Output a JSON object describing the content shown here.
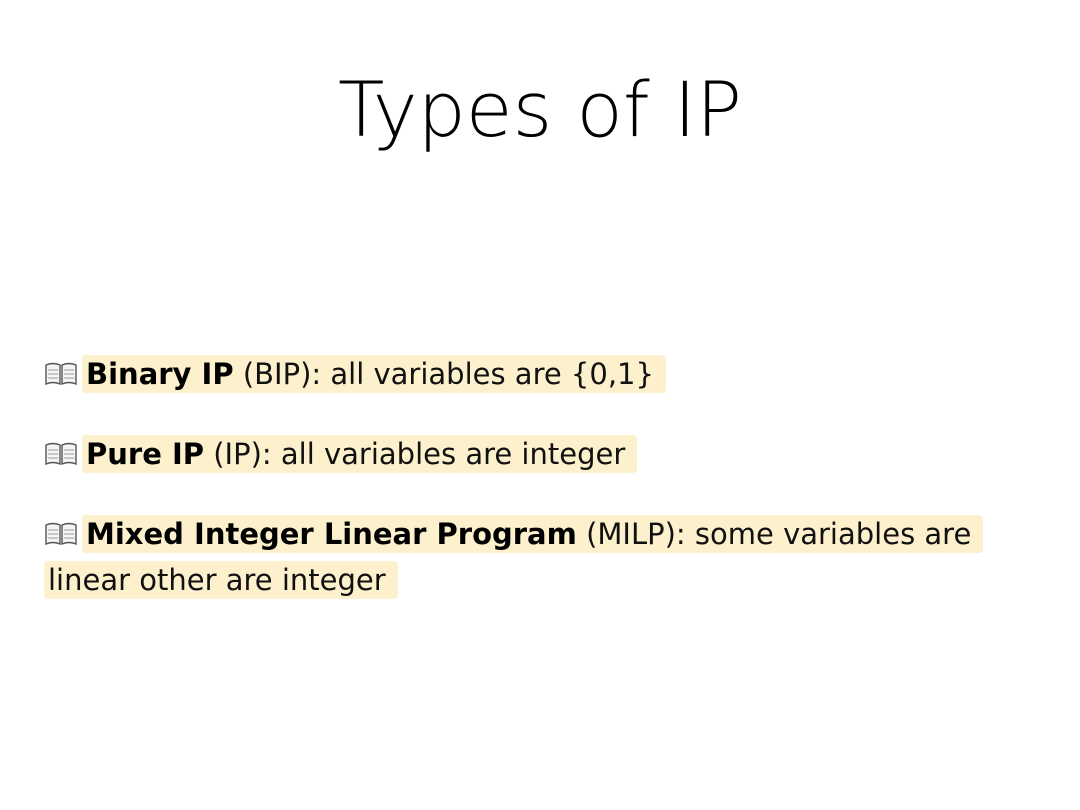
{
  "slide": {
    "title": "Types of IP",
    "icon": "open-book-icon",
    "highlight_color": "#fdf0cc",
    "items": [
      {
        "term": "Binary IP",
        "rest": " (BIP): all variables are {0,1}"
      },
      {
        "term": "Pure IP",
        "rest": " (IP): all variables are integer"
      },
      {
        "term": "Mixed Integer Linear Program",
        "rest": " (MILP): some variables are linear other are integer"
      }
    ]
  }
}
